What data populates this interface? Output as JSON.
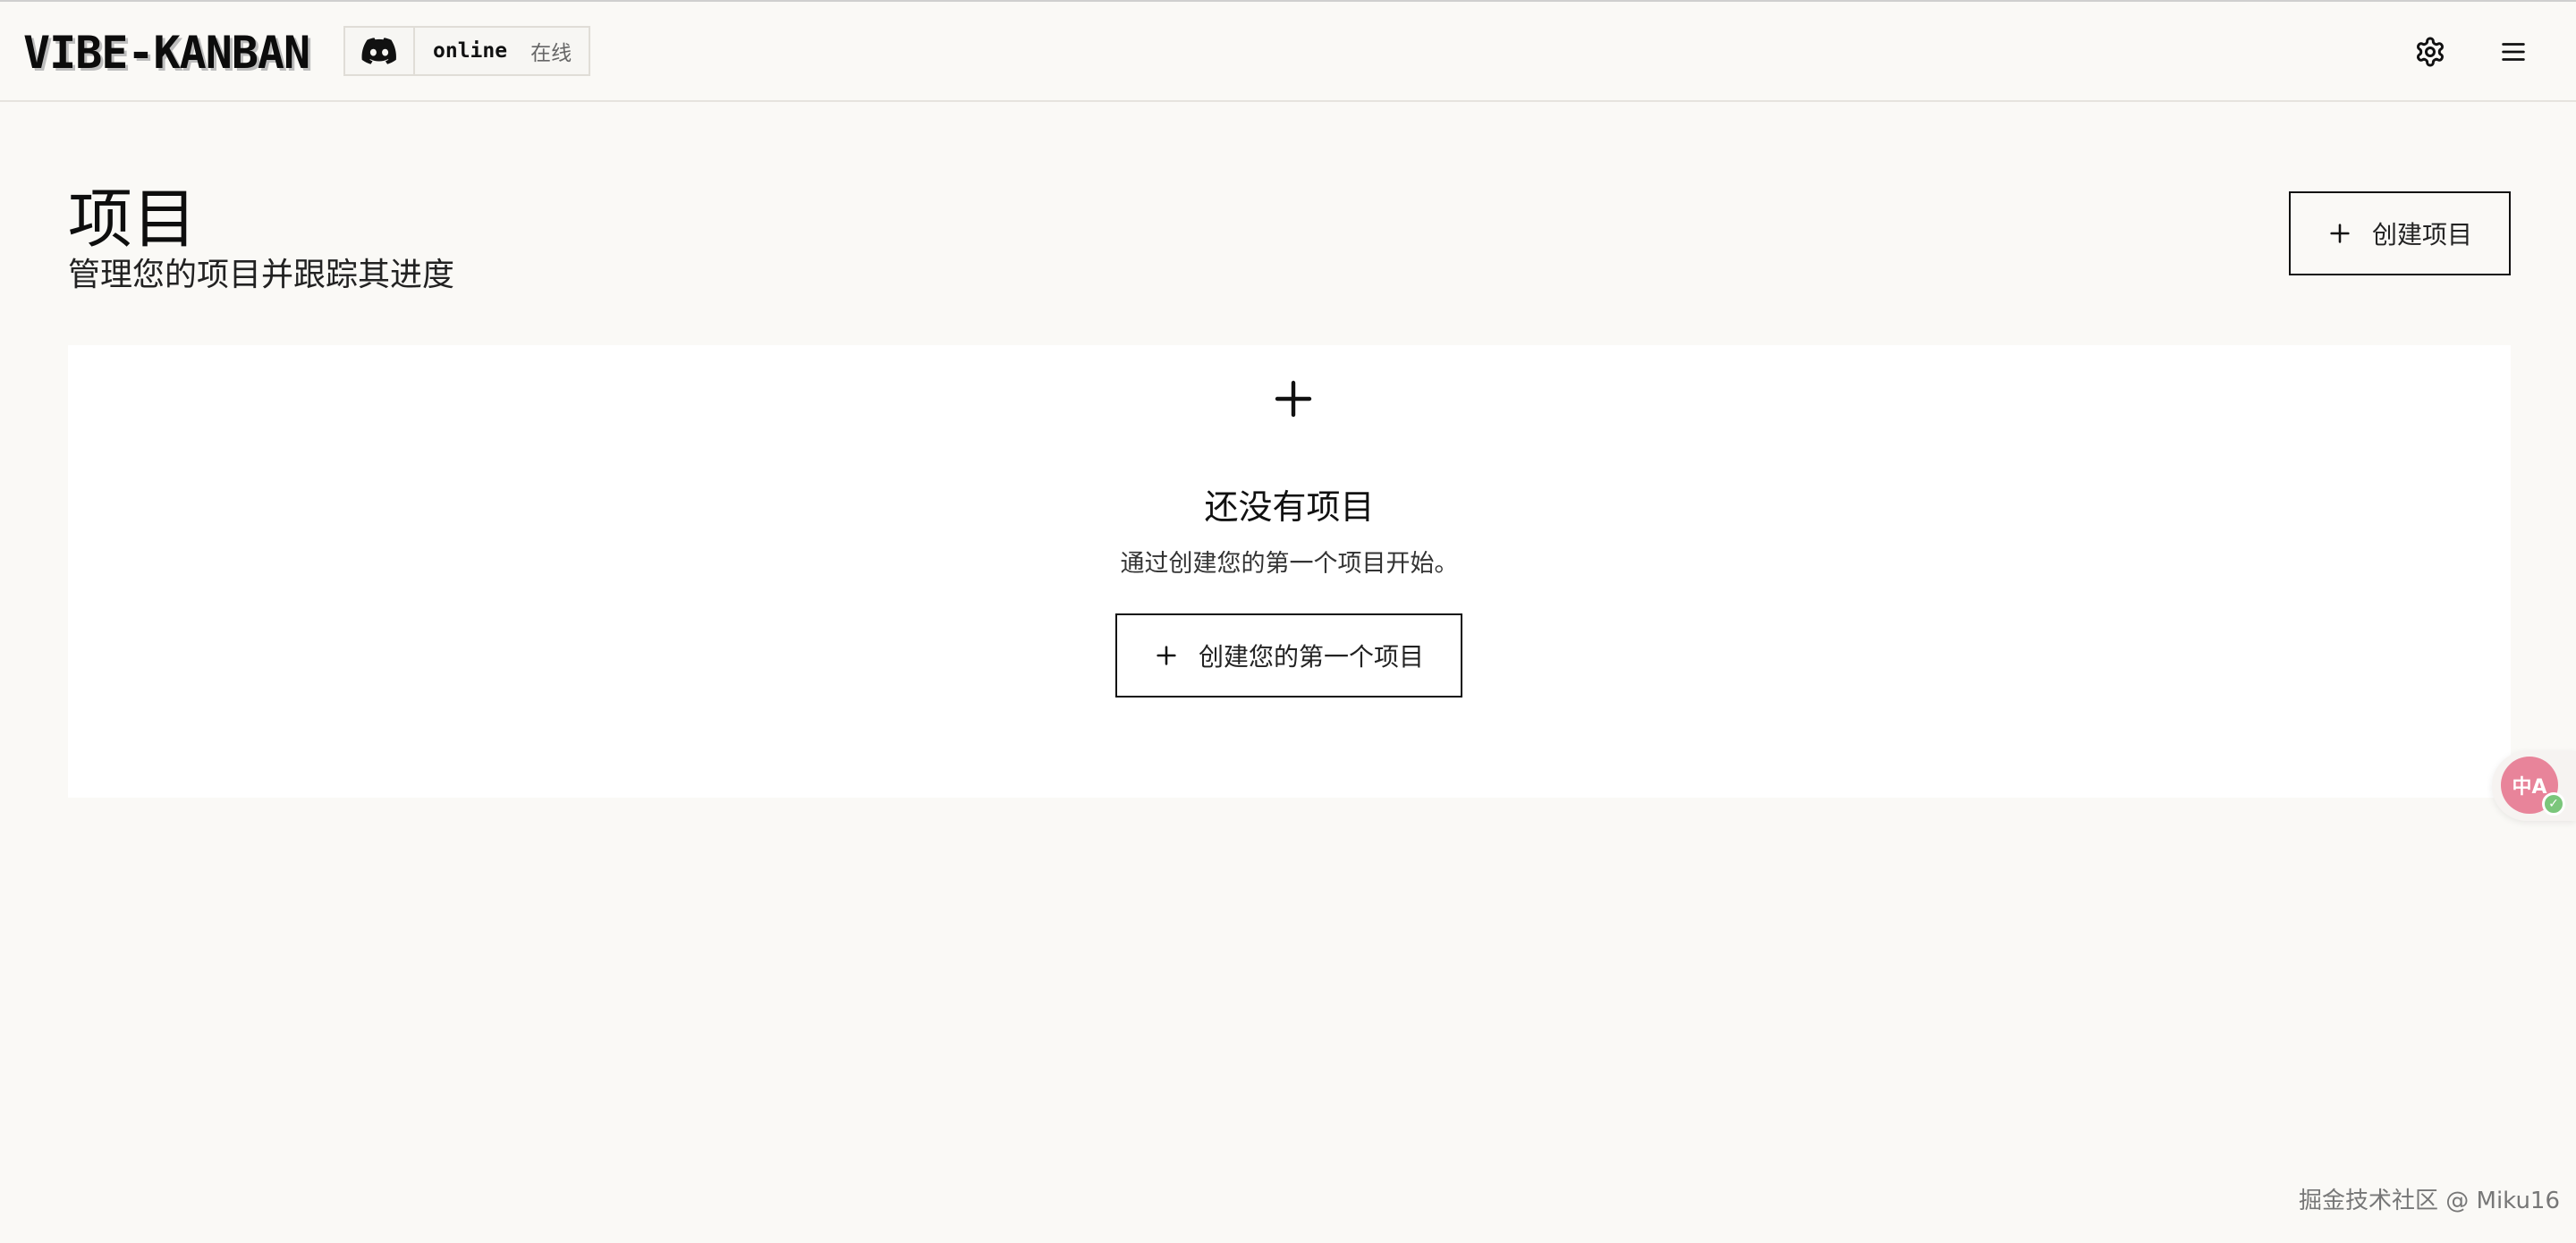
{
  "header": {
    "logo": "VIBE-KANBAN",
    "discord": {
      "icon": "discord-icon",
      "status": "online",
      "status_label": "在线"
    },
    "settings_icon": "gear-icon",
    "menu_icon": "hamburger-menu-icon"
  },
  "page": {
    "title": "项目",
    "subtitle": "管理您的项目并跟踪其进度",
    "create_button_label": "创建项目"
  },
  "empty_state": {
    "title": "还没有项目",
    "description": "通过创建您的第一个项目开始。",
    "button_label": "创建您的第一个项目"
  },
  "translate_widget": {
    "label": "中A"
  },
  "watermark": "掘金技术社区 @ Miku16",
  "colors": {
    "background": "#faf9f6",
    "card": "#ffffff",
    "border": "#111111",
    "translate_accent": "#e8849a"
  }
}
